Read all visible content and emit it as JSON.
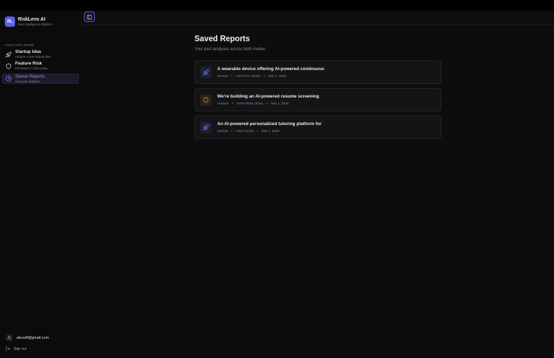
{
  "brand": {
    "initials": "RL",
    "name": "RiskLens AI",
    "subtitle": "Risk Intelligence Platform",
    "logo_color": "#5b63e6"
  },
  "sidebar": {
    "section_label": "ANALYSIS MODE",
    "items": [
      {
        "title": "Startup Idea",
        "subtitle": "Analyze a new startup idea",
        "icon": "rocket-icon",
        "active": false
      },
      {
        "title": "Feature Risk",
        "subtitle": "Pre-launch AI risk review",
        "icon": "shield-icon",
        "active": false
      },
      {
        "title": "Saved Reports",
        "subtitle": "View past analyses",
        "icon": "clock-icon",
        "active": true
      }
    ]
  },
  "user": {
    "email": "abcedf@gmail.com",
    "signout_label": "Sign out"
  },
  "page": {
    "title": "Saved Reports",
    "subtitle": "Your past analyses across both modes"
  },
  "reports": [
    {
      "title": "A wearable device offering AI-powered continuous",
      "type": "Startup",
      "risk": "CRITICAL (8/10)",
      "date": "Mar 1, 2026",
      "icon": "rocket-icon"
    },
    {
      "title": "We're building an AI-powered resume screening",
      "type": "Feature",
      "risk": "HIGH RISK (8/10)",
      "date": "Mar 1, 2026",
      "icon": "shield-icon"
    },
    {
      "title": "An AI-powered personalized tutoring platform for",
      "type": "Startup",
      "risk": "HIGH (6/10)",
      "date": "Mar 1, 2026",
      "icon": "rocket-icon"
    }
  ],
  "colors": {
    "accent": "#5b63e6",
    "feature_icon": "#d99a3a",
    "startup_icon": "#7d84ee"
  }
}
